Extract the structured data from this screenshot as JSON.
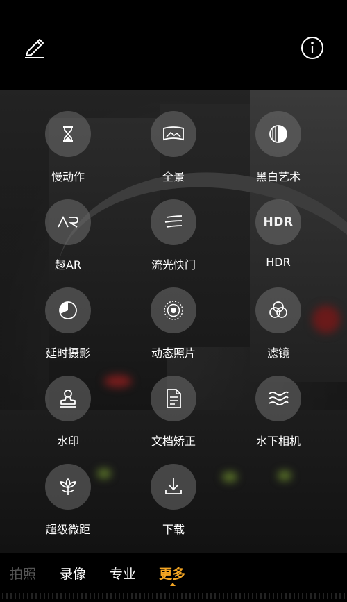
{
  "colors": {
    "accent": "#f5a623",
    "text": "#ffffff",
    "circle": "#6e6e6e"
  },
  "header": {
    "edit_icon": "pencil-icon",
    "info_icon": "info-circle-icon"
  },
  "modes_grid": [
    {
      "label": "慢动作",
      "icon": "hourglass-icon"
    },
    {
      "label": "全景",
      "icon": "panorama-icon"
    },
    {
      "label": "黑白艺术",
      "icon": "monochrome-icon"
    },
    {
      "label": "趣AR",
      "icon": "ar-icon"
    },
    {
      "label": "流光快门",
      "icon": "light-trail-icon"
    },
    {
      "label": "HDR",
      "icon": "hdr-icon",
      "icon_text": "HDR"
    },
    {
      "label": "延时摄影",
      "icon": "timelapse-icon"
    },
    {
      "label": "动态照片",
      "icon": "moving-picture-icon"
    },
    {
      "label": "滤镜",
      "icon": "filter-icon"
    },
    {
      "label": "水印",
      "icon": "watermark-stamp-icon"
    },
    {
      "label": "文档矫正",
      "icon": "document-icon"
    },
    {
      "label": "水下相机",
      "icon": "underwater-waves-icon"
    },
    {
      "label": "超级微距",
      "icon": "macro-flower-icon"
    },
    {
      "label": "下载",
      "icon": "download-icon"
    }
  ],
  "bottom_modes": {
    "photo": "拍照",
    "video": "录像",
    "pro": "专业",
    "more": "更多",
    "selected": "更多"
  }
}
